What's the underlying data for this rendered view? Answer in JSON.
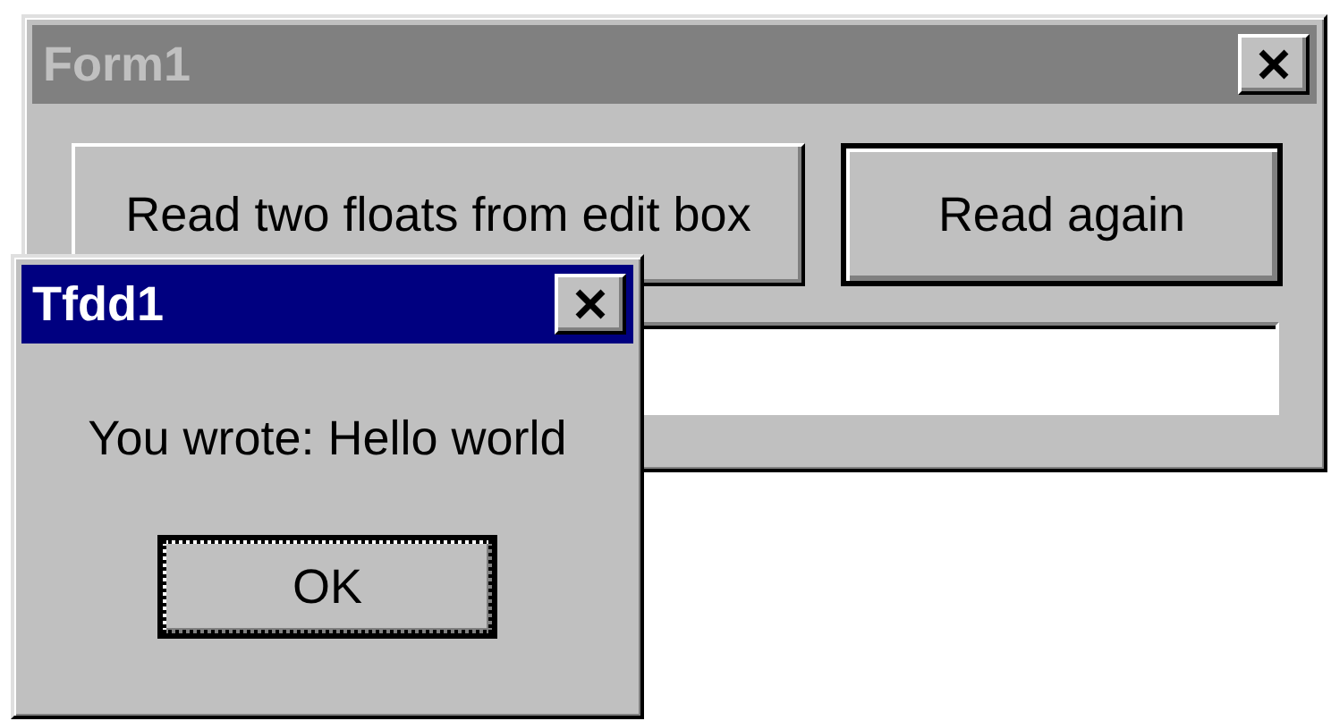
{
  "form1": {
    "title": "Form1",
    "active": false,
    "buttons": [
      {
        "label": "Read two floats from edit box",
        "default": false
      },
      {
        "label": "Read again",
        "default": true
      }
    ]
  },
  "dialog": {
    "title": "Tfdd1",
    "active": true,
    "message": "You wrote: Hello world",
    "button": {
      "label": "OK",
      "focused": true
    }
  }
}
